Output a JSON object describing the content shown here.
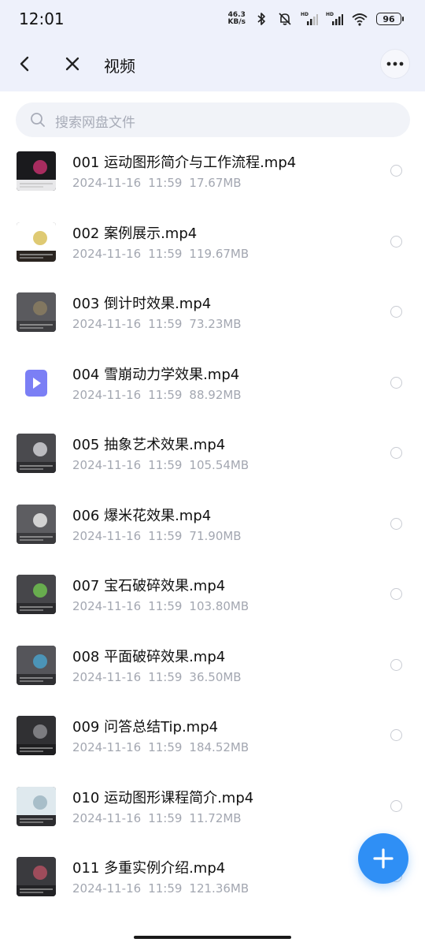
{
  "status_bar": {
    "time": "12:01",
    "net_speed_value": "46.3",
    "net_speed_unit": "KB/s",
    "hd_label": "HD",
    "battery": "96"
  },
  "nav": {
    "title": "视频"
  },
  "search": {
    "placeholder": "搜索网盘文件"
  },
  "files": [
    {
      "name": "001 运动图形简介与工作流程.mp4",
      "date": "2024-11-16",
      "time": "11:59",
      "size": "17.67MB",
      "thumb": "video-frame"
    },
    {
      "name": "002 案例展示.mp4",
      "date": "2024-11-16",
      "time": "11:59",
      "size": "119.67MB",
      "thumb": "video-frame"
    },
    {
      "name": "003 倒计时效果.mp4",
      "date": "2024-11-16",
      "time": "11:59",
      "size": "73.23MB",
      "thumb": "video-frame"
    },
    {
      "name": "004 雪崩动力学效果.mp4",
      "date": "2024-11-16",
      "time": "11:59",
      "size": "88.92MB",
      "thumb": "video-file-icon"
    },
    {
      "name": "005 抽象艺术效果.mp4",
      "date": "2024-11-16",
      "time": "11:59",
      "size": "105.54MB",
      "thumb": "video-frame"
    },
    {
      "name": "006 爆米花效果.mp4",
      "date": "2024-11-16",
      "time": "11:59",
      "size": "71.90MB",
      "thumb": "video-frame"
    },
    {
      "name": "007 宝石破碎效果.mp4",
      "date": "2024-11-16",
      "time": "11:59",
      "size": "103.80MB",
      "thumb": "video-frame"
    },
    {
      "name": "008 平面破碎效果.mp4",
      "date": "2024-11-16",
      "time": "11:59",
      "size": "36.50MB",
      "thumb": "video-frame"
    },
    {
      "name": "009 问答总结Tip.mp4",
      "date": "2024-11-16",
      "time": "11:59",
      "size": "184.52MB",
      "thumb": "video-frame"
    },
    {
      "name": "010 运动图形课程简介.mp4",
      "date": "2024-11-16",
      "time": "11:59",
      "size": "11.72MB",
      "thumb": "video-frame"
    },
    {
      "name": "011 多重实例介绍.mp4",
      "date": "2024-11-16",
      "time": "11:59",
      "size": "121.36MB",
      "thumb": "video-frame"
    }
  ],
  "colors": {
    "header_bg": "#eef1fb",
    "accent": "#2f8ff5",
    "video_icon": "#7b7ff5",
    "meta_text": "#a3a7b1"
  },
  "icons": {
    "back": "chevron-left-icon",
    "close": "close-icon",
    "more": "more-icon",
    "search": "search-icon",
    "add": "plus-icon"
  }
}
